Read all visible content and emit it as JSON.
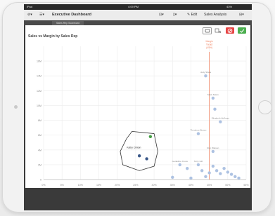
{
  "statusbar": {
    "carrier": "iPad",
    "time": "4:09 PM",
    "battery": "43%"
  },
  "toolbar": {
    "app_title": "Executive Dashboard",
    "edit_label": "Edit",
    "sheet_title": "Sales Analysis"
  },
  "sheetbar": {
    "active_tab": "Sales Rep Scorecard"
  },
  "panel": {
    "title": "Sales vs Margin by Sales Rep"
  },
  "colors": {
    "point": "#6a8fc4",
    "point_light": "#a9bfe0",
    "target_line": "#f08a6a",
    "selected_point": "#3a9a3a",
    "confirm_button": "#4caf50",
    "cancel_button": "#e64545"
  },
  "chart_data": {
    "type": "scatter",
    "xlabel": "",
    "ylabel": "",
    "xlim": [
      0,
      55
    ],
    "ylim": [
      0,
      18000000
    ],
    "x_ticks": [
      "0%",
      "5%",
      "10%",
      "15%",
      "20%",
      "25%",
      "30%",
      "35%",
      "40%",
      "45%",
      "50%",
      "55%"
    ],
    "y_ticks": [
      "0",
      "2M",
      "4M",
      "6M",
      "8M",
      "10M",
      "12M",
      "14M",
      "16M"
    ],
    "grid": true,
    "reference_line": {
      "label": "Margin Target (45%)",
      "x": 45
    },
    "lasso_label": "Kathy Clinton",
    "series": [
      {
        "points": [
          {
            "x": 44,
            "y": 14000000,
            "label": "Judy Shaw"
          },
          {
            "x": 46,
            "y": 11000000,
            "label": "Mark Nolan"
          },
          {
            "x": 46.5,
            "y": 9500000,
            "label": ""
          },
          {
            "x": 48,
            "y": 7800000,
            "label": "Elizabeth Hoffman"
          },
          {
            "x": 42,
            "y": 6200000,
            "label": "Theodore Brown"
          },
          {
            "x": 46,
            "y": 3800000,
            "label": "Ron Watson"
          },
          {
            "x": 29,
            "y": 5800000,
            "label": ""
          },
          {
            "x": 26,
            "y": 3200000,
            "label": ""
          },
          {
            "x": 28,
            "y": 2800000,
            "label": ""
          },
          {
            "x": 37,
            "y": 2000000,
            "label": "Geraldine Cross"
          },
          {
            "x": 42,
            "y": 2000000,
            "label": "Terry Gill"
          },
          {
            "x": 39,
            "y": 1500000,
            "label": ""
          },
          {
            "x": 43,
            "y": 1200000,
            "label": ""
          },
          {
            "x": 45,
            "y": 900000,
            "label": ""
          },
          {
            "x": 46,
            "y": 1800000,
            "label": ""
          },
          {
            "x": 47,
            "y": 1200000,
            "label": ""
          },
          {
            "x": 48,
            "y": 800000,
            "label": ""
          },
          {
            "x": 49,
            "y": 1500000,
            "label": ""
          },
          {
            "x": 50,
            "y": 1000000,
            "label": ""
          },
          {
            "x": 51,
            "y": 700000,
            "label": ""
          },
          {
            "x": 52,
            "y": 400000,
            "label": ""
          },
          {
            "x": 53,
            "y": 200000,
            "label": ""
          },
          {
            "x": 35,
            "y": 300000,
            "label": ""
          },
          {
            "x": 40,
            "y": 200000,
            "label": ""
          },
          {
            "x": 44,
            "y": 400000,
            "label": ""
          }
        ]
      }
    ]
  }
}
